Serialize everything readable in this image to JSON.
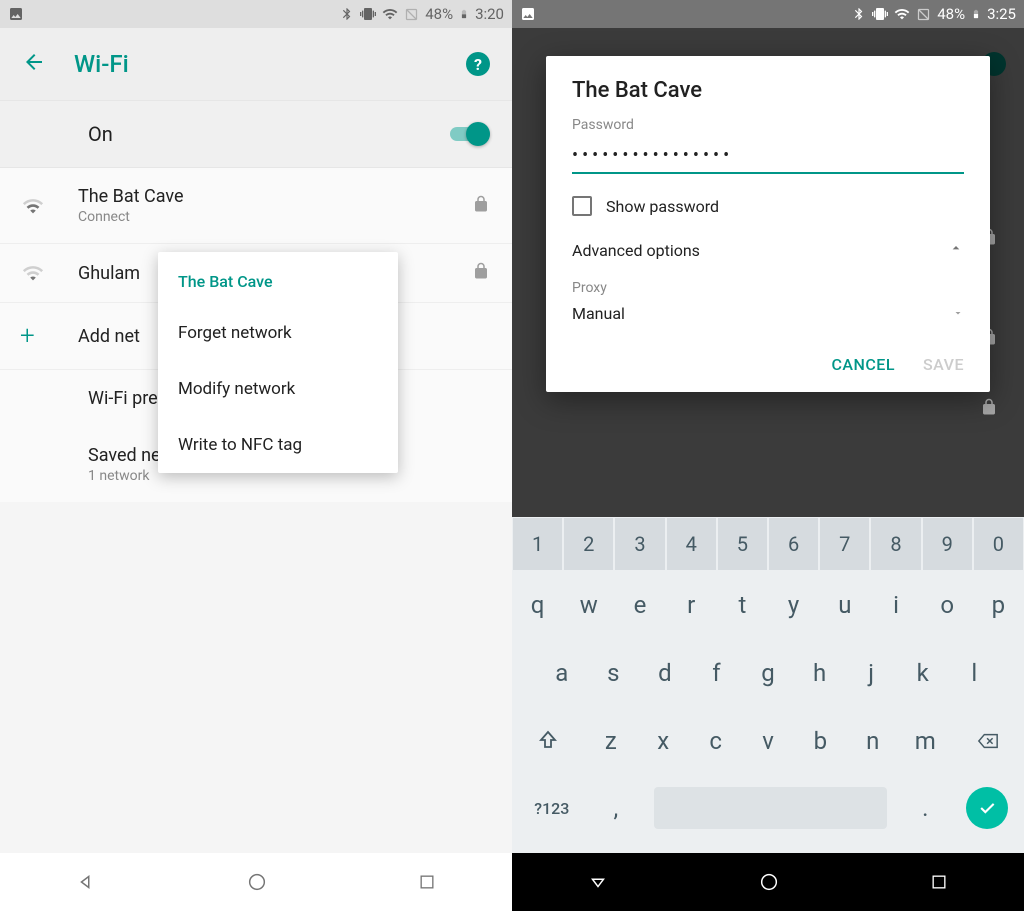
{
  "left": {
    "status": {
      "battery": "48%",
      "time": "3:20"
    },
    "appbar": {
      "title": "Wi-Fi"
    },
    "wifi_toggle": {
      "label": "On"
    },
    "networks": {
      "n0": {
        "name": "The Bat Cave",
        "status": "Connect"
      },
      "n1": {
        "name": "Ghulam"
      },
      "add": {
        "label": "Add net"
      }
    },
    "prefs": {
      "label": "Wi-Fi preferences"
    },
    "saved": {
      "label": "Saved networks",
      "sub": "1 network"
    },
    "popup": {
      "title": "The Bat Cave",
      "items": {
        "i0": "Forget network",
        "i1": "Modify network",
        "i2": "Write to NFC tag"
      }
    }
  },
  "right": {
    "status": {
      "battery": "48%",
      "time": "3:25"
    },
    "dialog": {
      "title": "The Bat Cave",
      "password_label": "Password",
      "password_value": "••••••••••••••••",
      "show_password": "Show password",
      "advanced": "Advanced options",
      "proxy_label": "Proxy",
      "proxy_value": "Manual",
      "cancel": "CANCEL",
      "save": "SAVE"
    },
    "keyboard": {
      "row_num": {
        "k0": "1",
        "k1": "2",
        "k2": "3",
        "k3": "4",
        "k4": "5",
        "k5": "6",
        "k6": "7",
        "k7": "8",
        "k8": "9",
        "k9": "0"
      },
      "row1": {
        "k0": "q",
        "k1": "w",
        "k2": "e",
        "k3": "r",
        "k4": "t",
        "k5": "y",
        "k6": "u",
        "k7": "i",
        "k8": "o",
        "k9": "p"
      },
      "row2": {
        "k0": "a",
        "k1": "s",
        "k2": "d",
        "k3": "f",
        "k4": "g",
        "k5": "h",
        "k6": "j",
        "k7": "k",
        "k8": "l"
      },
      "row3": {
        "k0": "z",
        "k1": "x",
        "k2": "c",
        "k3": "v",
        "k4": "b",
        "k5": "n",
        "k6": "m"
      },
      "row4": {
        "sym": "?123",
        "comma": ",",
        "period": "."
      }
    }
  }
}
